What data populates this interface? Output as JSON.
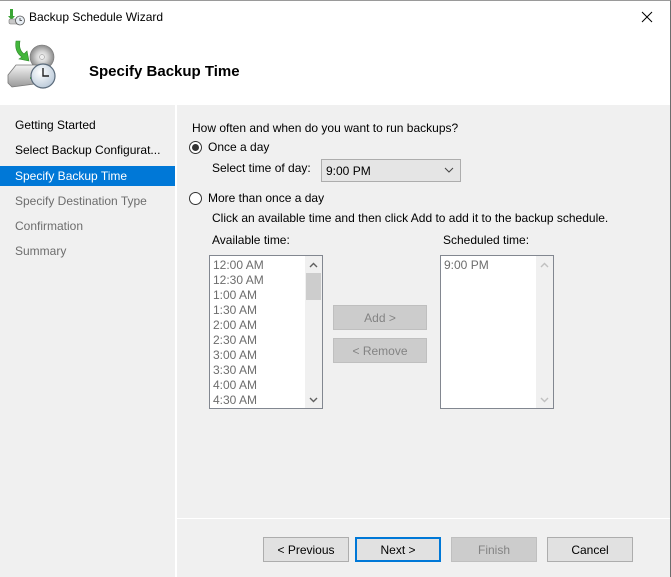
{
  "window": {
    "title": "Backup Schedule Wizard",
    "close_icon": "close-icon"
  },
  "header": {
    "title": "Specify Backup Time",
    "icon": "backup-schedule-icon"
  },
  "sidebar": {
    "items": [
      {
        "label": "Getting Started",
        "state": "done"
      },
      {
        "label": "Select Backup Configurat...",
        "state": "done"
      },
      {
        "label": "Specify Backup Time",
        "state": "active"
      },
      {
        "label": "Specify Destination Type",
        "state": "pending"
      },
      {
        "label": "Confirmation",
        "state": "pending"
      },
      {
        "label": "Summary",
        "state": "pending"
      }
    ]
  },
  "main": {
    "question": "How often and when do you want to run backups?",
    "once_a_day": {
      "label": "Once a day",
      "selected": true,
      "time_label": "Select time of day:",
      "time_value": "9:00 PM"
    },
    "more_than_once": {
      "label": "More than once a day",
      "selected": false,
      "instructions": "Click an available time and then click Add to add it to the backup schedule.",
      "available_label": "Available time:",
      "available_times": [
        "12:00 AM",
        "12:30 AM",
        "1:00 AM",
        "1:30 AM",
        "2:00 AM",
        "2:30 AM",
        "3:00 AM",
        "3:30 AM",
        "4:00 AM",
        "4:30 AM"
      ],
      "scheduled_label": "Scheduled time:",
      "scheduled_times": [
        "9:00 PM"
      ],
      "add_label": "Add >",
      "remove_label": "< Remove"
    }
  },
  "footer": {
    "previous_label": "< Previous",
    "next_label": "Next >",
    "finish_label": "Finish",
    "cancel_label": "Cancel"
  },
  "colors": {
    "accent": "#0078d7",
    "panel_bg": "#f0f0f0",
    "disabled_text": "#838383"
  }
}
